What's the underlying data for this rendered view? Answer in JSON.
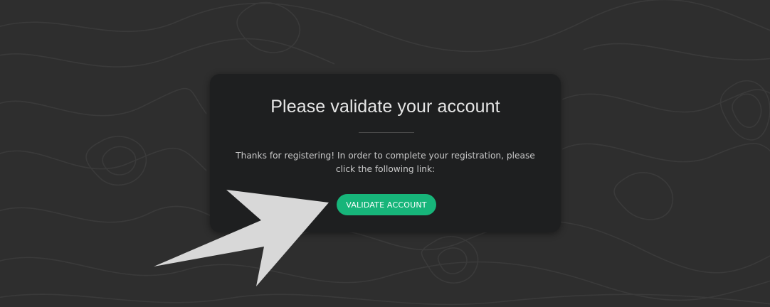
{
  "dialog": {
    "title": "Please validate your account",
    "message": "Thanks for registering! In order to complete your registration, please click the following link:",
    "button_label": "VALIDATE ACCOUNT"
  },
  "colors": {
    "background": "#2e2e2e",
    "card": "#1e1f20",
    "accent": "#17b57a",
    "arrow": "#d8d8d8"
  },
  "icons": {
    "annotation": "pointer-arrow-icon"
  }
}
